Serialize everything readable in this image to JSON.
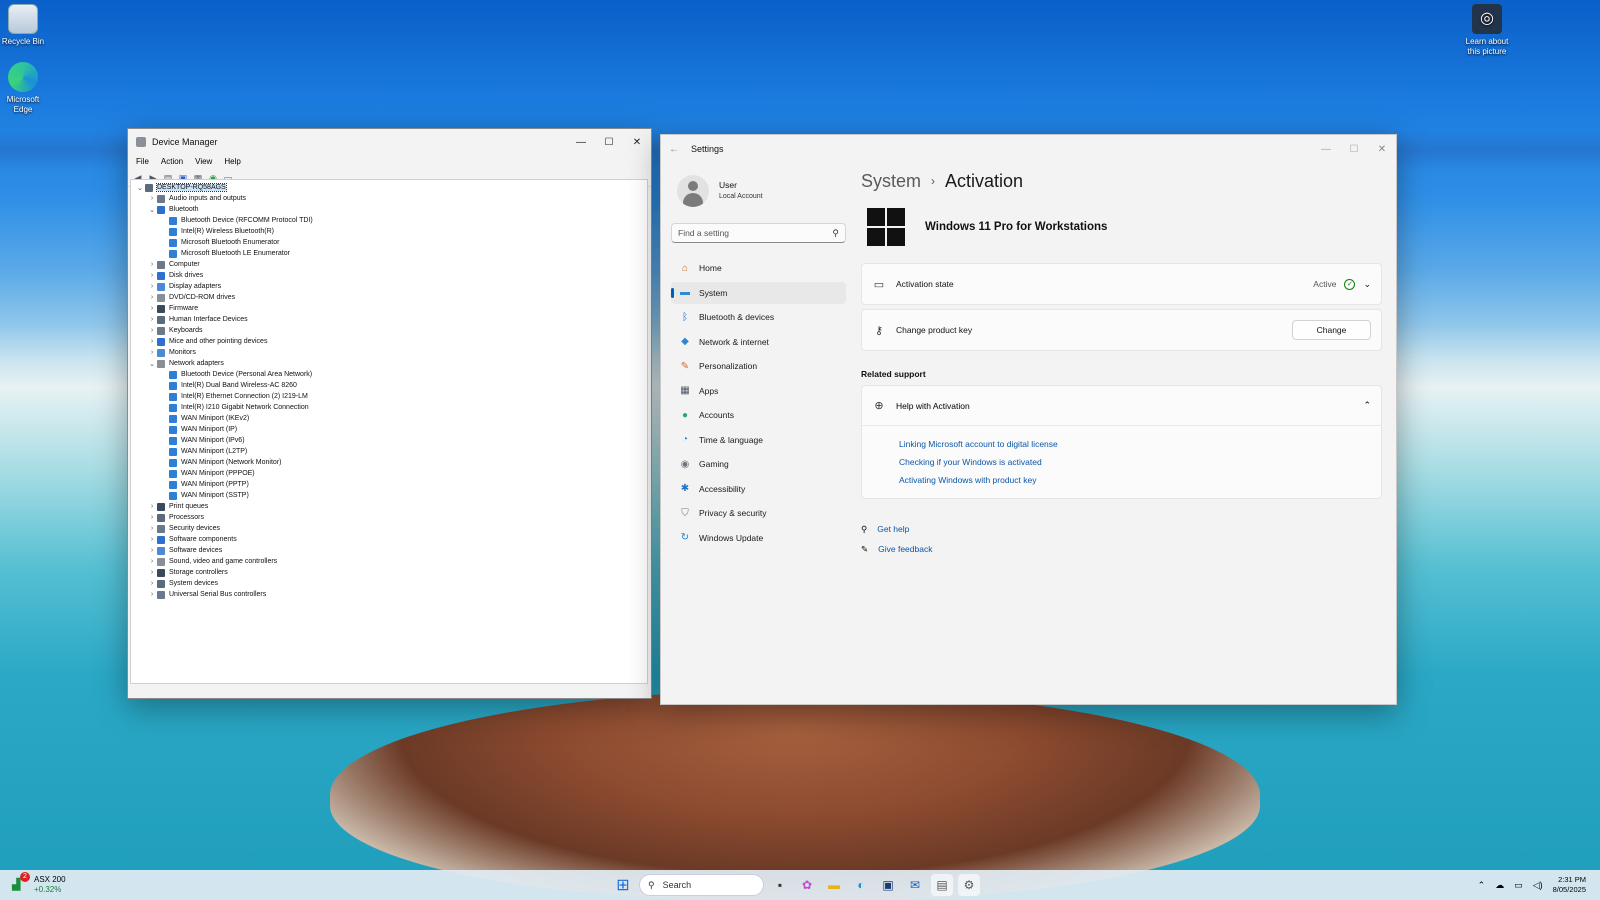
{
  "desktop": {
    "icons": [
      {
        "label": "Recycle Bin"
      },
      {
        "label": "Microsoft Edge"
      },
      {
        "label": "Learn about this picture"
      }
    ]
  },
  "device_manager": {
    "title": "Device Manager",
    "menu": [
      "File",
      "Action",
      "View",
      "Help"
    ],
    "tree": [
      {
        "label": "DESKTOP-RQ58AGS",
        "level": 0,
        "expanded": true,
        "selected": true
      },
      {
        "label": "Audio inputs and outputs",
        "level": 1,
        "expanded": false
      },
      {
        "label": "Bluetooth",
        "level": 1,
        "expanded": true
      },
      {
        "label": "Bluetooth Device (RFCOMM Protocol TDI)",
        "level": 2
      },
      {
        "label": "Intel(R) Wireless Bluetooth(R)",
        "level": 2
      },
      {
        "label": "Microsoft Bluetooth Enumerator",
        "level": 2
      },
      {
        "label": "Microsoft Bluetooth LE Enumerator",
        "level": 2
      },
      {
        "label": "Computer",
        "level": 1,
        "expanded": false
      },
      {
        "label": "Disk drives",
        "level": 1,
        "expanded": false
      },
      {
        "label": "Display adapters",
        "level": 1,
        "expanded": false
      },
      {
        "label": "DVD/CD-ROM drives",
        "level": 1,
        "expanded": false
      },
      {
        "label": "Firmware",
        "level": 1,
        "expanded": false
      },
      {
        "label": "Human Interface Devices",
        "level": 1,
        "expanded": false
      },
      {
        "label": "Keyboards",
        "level": 1,
        "expanded": false
      },
      {
        "label": "Mice and other pointing devices",
        "level": 1,
        "expanded": false
      },
      {
        "label": "Monitors",
        "level": 1,
        "expanded": false
      },
      {
        "label": "Network adapters",
        "level": 1,
        "expanded": true
      },
      {
        "label": "Bluetooth Device (Personal Area Network)",
        "level": 2
      },
      {
        "label": "Intel(R) Dual Band Wireless-AC 8260",
        "level": 2
      },
      {
        "label": "Intel(R) Ethernet Connection (2) I219-LM",
        "level": 2
      },
      {
        "label": "Intel(R) I210 Gigabit Network Connection",
        "level": 2
      },
      {
        "label": "WAN Miniport (IKEv2)",
        "level": 2
      },
      {
        "label": "WAN Miniport (IP)",
        "level": 2
      },
      {
        "label": "WAN Miniport (IPv6)",
        "level": 2
      },
      {
        "label": "WAN Miniport (L2TP)",
        "level": 2
      },
      {
        "label": "WAN Miniport (Network Monitor)",
        "level": 2
      },
      {
        "label": "WAN Miniport (PPPOE)",
        "level": 2
      },
      {
        "label": "WAN Miniport (PPTP)",
        "level": 2
      },
      {
        "label": "WAN Miniport (SSTP)",
        "level": 2
      },
      {
        "label": "Print queues",
        "level": 1,
        "expanded": false
      },
      {
        "label": "Processors",
        "level": 1,
        "expanded": false
      },
      {
        "label": "Security devices",
        "level": 1,
        "expanded": false
      },
      {
        "label": "Software components",
        "level": 1,
        "expanded": false
      },
      {
        "label": "Software devices",
        "level": 1,
        "expanded": false
      },
      {
        "label": "Sound, video and game controllers",
        "level": 1,
        "expanded": false
      },
      {
        "label": "Storage controllers",
        "level": 1,
        "expanded": false
      },
      {
        "label": "System devices",
        "level": 1,
        "expanded": false
      },
      {
        "label": "Universal Serial Bus controllers",
        "level": 1,
        "expanded": false
      }
    ]
  },
  "settings": {
    "title": "Settings",
    "user": {
      "name": "User",
      "account": "Local Account"
    },
    "search_placeholder": "Find a setting",
    "nav": [
      {
        "label": "Home",
        "icon": "home-icon",
        "color": "#c0692c"
      },
      {
        "label": "System",
        "icon": "system-icon",
        "color": "#2d8bd6",
        "selected": true
      },
      {
        "label": "Bluetooth & devices",
        "icon": "bluetooth-icon",
        "color": "#1a73c8"
      },
      {
        "label": "Network & internet",
        "icon": "wifi-icon",
        "color": "#2f86d0"
      },
      {
        "label": "Personalization",
        "icon": "brush-icon",
        "color": "#d9662a"
      },
      {
        "label": "Apps",
        "icon": "apps-icon",
        "color": "#4a5463"
      },
      {
        "label": "Accounts",
        "icon": "person-icon",
        "color": "#2ea86a"
      },
      {
        "label": "Time & language",
        "icon": "globe-icon",
        "color": "#2b85c6"
      },
      {
        "label": "Gaming",
        "icon": "controller-icon",
        "color": "#6d7680"
      },
      {
        "label": "Accessibility",
        "icon": "accessibility-icon",
        "color": "#1f73c9"
      },
      {
        "label": "Privacy & security",
        "icon": "shield-icon",
        "color": "#6e7a86"
      },
      {
        "label": "Windows Update",
        "icon": "update-icon",
        "color": "#1d7fd2"
      }
    ],
    "breadcrumb": {
      "parent": "System",
      "current": "Activation"
    },
    "edition": "Windows 11 Pro for Workstations",
    "activation_state": {
      "label": "Activation state",
      "value": "Active"
    },
    "product_key": {
      "label": "Change product key",
      "button": "Change"
    },
    "related_support": "Related support",
    "help": {
      "title": "Help with Activation",
      "links": [
        "Linking Microsoft account to digital license",
        "Checking if your Windows is activated",
        "Activating Windows with product key"
      ]
    },
    "footer": {
      "get_help": "Get help",
      "feedback": "Give feedback"
    }
  },
  "taskbar": {
    "widget": {
      "badge": "2",
      "name": "ASX 200",
      "change": "+0.32%"
    },
    "search_label": "Search",
    "time": "2:31 PM",
    "date": "8/05/2025"
  }
}
